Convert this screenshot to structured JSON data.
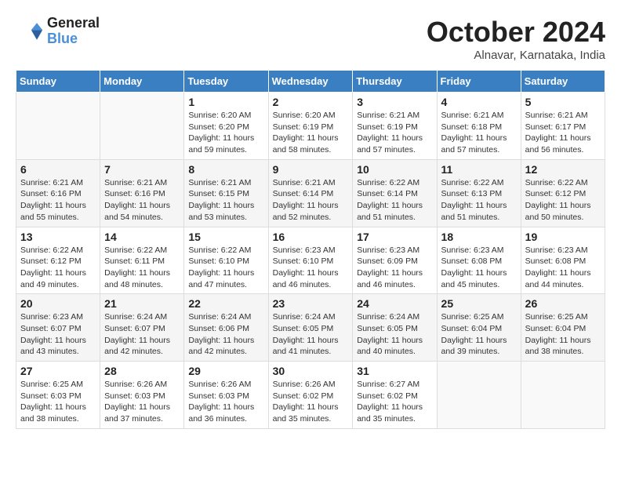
{
  "header": {
    "logo_line1": "General",
    "logo_line2": "Blue",
    "month_title": "October 2024",
    "location": "Alnavar, Karnataka, India"
  },
  "weekdays": [
    "Sunday",
    "Monday",
    "Tuesday",
    "Wednesday",
    "Thursday",
    "Friday",
    "Saturday"
  ],
  "weeks": [
    [
      {
        "day": "",
        "sunrise": "",
        "sunset": "",
        "daylight": ""
      },
      {
        "day": "",
        "sunrise": "",
        "sunset": "",
        "daylight": ""
      },
      {
        "day": "1",
        "sunrise": "Sunrise: 6:20 AM",
        "sunset": "Sunset: 6:20 PM",
        "daylight": "Daylight: 11 hours and 59 minutes."
      },
      {
        "day": "2",
        "sunrise": "Sunrise: 6:20 AM",
        "sunset": "Sunset: 6:19 PM",
        "daylight": "Daylight: 11 hours and 58 minutes."
      },
      {
        "day": "3",
        "sunrise": "Sunrise: 6:21 AM",
        "sunset": "Sunset: 6:19 PM",
        "daylight": "Daylight: 11 hours and 57 minutes."
      },
      {
        "day": "4",
        "sunrise": "Sunrise: 6:21 AM",
        "sunset": "Sunset: 6:18 PM",
        "daylight": "Daylight: 11 hours and 57 minutes."
      },
      {
        "day": "5",
        "sunrise": "Sunrise: 6:21 AM",
        "sunset": "Sunset: 6:17 PM",
        "daylight": "Daylight: 11 hours and 56 minutes."
      }
    ],
    [
      {
        "day": "6",
        "sunrise": "Sunrise: 6:21 AM",
        "sunset": "Sunset: 6:16 PM",
        "daylight": "Daylight: 11 hours and 55 minutes."
      },
      {
        "day": "7",
        "sunrise": "Sunrise: 6:21 AM",
        "sunset": "Sunset: 6:16 PM",
        "daylight": "Daylight: 11 hours and 54 minutes."
      },
      {
        "day": "8",
        "sunrise": "Sunrise: 6:21 AM",
        "sunset": "Sunset: 6:15 PM",
        "daylight": "Daylight: 11 hours and 53 minutes."
      },
      {
        "day": "9",
        "sunrise": "Sunrise: 6:21 AM",
        "sunset": "Sunset: 6:14 PM",
        "daylight": "Daylight: 11 hours and 52 minutes."
      },
      {
        "day": "10",
        "sunrise": "Sunrise: 6:22 AM",
        "sunset": "Sunset: 6:14 PM",
        "daylight": "Daylight: 11 hours and 51 minutes."
      },
      {
        "day": "11",
        "sunrise": "Sunrise: 6:22 AM",
        "sunset": "Sunset: 6:13 PM",
        "daylight": "Daylight: 11 hours and 51 minutes."
      },
      {
        "day": "12",
        "sunrise": "Sunrise: 6:22 AM",
        "sunset": "Sunset: 6:12 PM",
        "daylight": "Daylight: 11 hours and 50 minutes."
      }
    ],
    [
      {
        "day": "13",
        "sunrise": "Sunrise: 6:22 AM",
        "sunset": "Sunset: 6:12 PM",
        "daylight": "Daylight: 11 hours and 49 minutes."
      },
      {
        "day": "14",
        "sunrise": "Sunrise: 6:22 AM",
        "sunset": "Sunset: 6:11 PM",
        "daylight": "Daylight: 11 hours and 48 minutes."
      },
      {
        "day": "15",
        "sunrise": "Sunrise: 6:22 AM",
        "sunset": "Sunset: 6:10 PM",
        "daylight": "Daylight: 11 hours and 47 minutes."
      },
      {
        "day": "16",
        "sunrise": "Sunrise: 6:23 AM",
        "sunset": "Sunset: 6:10 PM",
        "daylight": "Daylight: 11 hours and 46 minutes."
      },
      {
        "day": "17",
        "sunrise": "Sunrise: 6:23 AM",
        "sunset": "Sunset: 6:09 PM",
        "daylight": "Daylight: 11 hours and 46 minutes."
      },
      {
        "day": "18",
        "sunrise": "Sunrise: 6:23 AM",
        "sunset": "Sunset: 6:08 PM",
        "daylight": "Daylight: 11 hours and 45 minutes."
      },
      {
        "day": "19",
        "sunrise": "Sunrise: 6:23 AM",
        "sunset": "Sunset: 6:08 PM",
        "daylight": "Daylight: 11 hours and 44 minutes."
      }
    ],
    [
      {
        "day": "20",
        "sunrise": "Sunrise: 6:23 AM",
        "sunset": "Sunset: 6:07 PM",
        "daylight": "Daylight: 11 hours and 43 minutes."
      },
      {
        "day": "21",
        "sunrise": "Sunrise: 6:24 AM",
        "sunset": "Sunset: 6:07 PM",
        "daylight": "Daylight: 11 hours and 42 minutes."
      },
      {
        "day": "22",
        "sunrise": "Sunrise: 6:24 AM",
        "sunset": "Sunset: 6:06 PM",
        "daylight": "Daylight: 11 hours and 42 minutes."
      },
      {
        "day": "23",
        "sunrise": "Sunrise: 6:24 AM",
        "sunset": "Sunset: 6:05 PM",
        "daylight": "Daylight: 11 hours and 41 minutes."
      },
      {
        "day": "24",
        "sunrise": "Sunrise: 6:24 AM",
        "sunset": "Sunset: 6:05 PM",
        "daylight": "Daylight: 11 hours and 40 minutes."
      },
      {
        "day": "25",
        "sunrise": "Sunrise: 6:25 AM",
        "sunset": "Sunset: 6:04 PM",
        "daylight": "Daylight: 11 hours and 39 minutes."
      },
      {
        "day": "26",
        "sunrise": "Sunrise: 6:25 AM",
        "sunset": "Sunset: 6:04 PM",
        "daylight": "Daylight: 11 hours and 38 minutes."
      }
    ],
    [
      {
        "day": "27",
        "sunrise": "Sunrise: 6:25 AM",
        "sunset": "Sunset: 6:03 PM",
        "daylight": "Daylight: 11 hours and 38 minutes."
      },
      {
        "day": "28",
        "sunrise": "Sunrise: 6:26 AM",
        "sunset": "Sunset: 6:03 PM",
        "daylight": "Daylight: 11 hours and 37 minutes."
      },
      {
        "day": "29",
        "sunrise": "Sunrise: 6:26 AM",
        "sunset": "Sunset: 6:03 PM",
        "daylight": "Daylight: 11 hours and 36 minutes."
      },
      {
        "day": "30",
        "sunrise": "Sunrise: 6:26 AM",
        "sunset": "Sunset: 6:02 PM",
        "daylight": "Daylight: 11 hours and 35 minutes."
      },
      {
        "day": "31",
        "sunrise": "Sunrise: 6:27 AM",
        "sunset": "Sunset: 6:02 PM",
        "daylight": "Daylight: 11 hours and 35 minutes."
      },
      {
        "day": "",
        "sunrise": "",
        "sunset": "",
        "daylight": ""
      },
      {
        "day": "",
        "sunrise": "",
        "sunset": "",
        "daylight": ""
      }
    ]
  ]
}
